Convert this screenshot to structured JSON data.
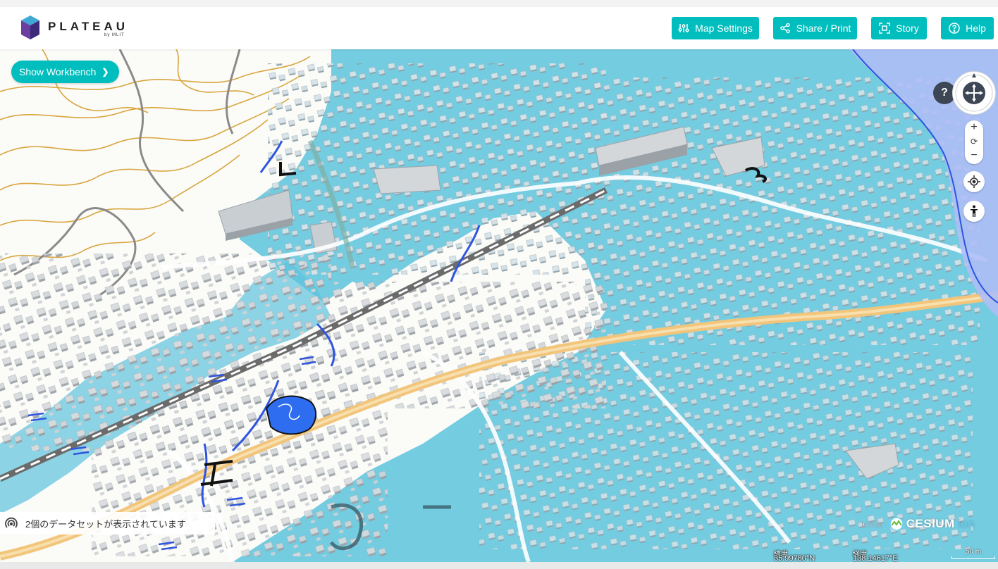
{
  "app": {
    "logo_text": "PLATEAU",
    "logo_sub": "by MLIT"
  },
  "header": {
    "buttons": [
      {
        "label": "Map Settings",
        "icon": "sliders-icon"
      },
      {
        "label": "Share / Print",
        "icon": "share-icon"
      },
      {
        "label": "Story",
        "icon": "story-icon"
      },
      {
        "label": "Help",
        "icon": "help-circle-icon"
      }
    ]
  },
  "workbench": {
    "label": "Show Workbench"
  },
  "nav": {
    "help_label": "?",
    "zoom_in": "+",
    "zoom_reset": "⟳",
    "zoom_out": "−"
  },
  "status": {
    "text": "2個のデータセットが表示されています"
  },
  "credits": {
    "terria": "terria",
    "cesium": "CESIUM",
    "cesium_suffix": "ion"
  },
  "coords": {
    "lat_label": "緯度",
    "lat_value": "35.99780°N",
    "lon_label": "経度",
    "lon_value": "138.14617°E"
  },
  "scale": {
    "label": "50 m"
  },
  "colors": {
    "accent": "#00bebe",
    "flood_overlay": "#5cc3dd",
    "building": "#d4d7da",
    "contour": "#d9a63f",
    "highway": "#f2c57b",
    "railway": "#6b6b6b",
    "water": "#2e55e0"
  }
}
